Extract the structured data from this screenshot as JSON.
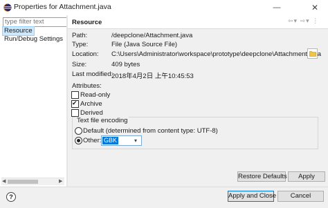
{
  "window": {
    "title": "Properties for Attachment.java"
  },
  "filter": {
    "placeholder": "type filter text"
  },
  "tree": {
    "items": [
      {
        "label": "Resource",
        "selected": true
      },
      {
        "label": "Run/Debug Settings",
        "selected": false
      }
    ]
  },
  "page": {
    "title": "Resource"
  },
  "fields": [
    {
      "label": "Path:",
      "value": "/deepclone/Attachment.java"
    },
    {
      "label": "Type:",
      "value": "File  (Java Source File)"
    },
    {
      "label": "Location:",
      "value": "C:\\Users\\Administrator\\workspace\\prototype\\deepclone\\Attachment.java"
    },
    {
      "label": "Size:",
      "value": "409  bytes"
    },
    {
      "label": "Last modified:",
      "value": "2018年4月2日 上午10:45:53"
    }
  ],
  "attributes": {
    "title": "Attributes:",
    "items": [
      {
        "label": "Read-only",
        "checked": false
      },
      {
        "label": "Archive",
        "checked": true
      },
      {
        "label": "Derived",
        "checked": false
      }
    ]
  },
  "encoding": {
    "title": "Text file encoding",
    "default_label": "Default (determined from content type: UTF-8)",
    "other_label": "Other:",
    "selected": "other",
    "other_value": "GBK"
  },
  "buttons": {
    "restore_defaults": "Restore Defaults",
    "apply": "Apply",
    "apply_and_close": "Apply and Close",
    "cancel": "Cancel"
  },
  "icons": {
    "app": "eclipse-icon",
    "help": "help-icon",
    "folder": "folder-icon",
    "nav": [
      "back-icon",
      "back-dropdown-icon",
      "forward-icon",
      "forward-dropdown-icon",
      "view-menu-icon"
    ]
  },
  "colors": {
    "selection": "#cce8ff",
    "combo_highlight": "#0078d7",
    "eclipse_purple": "#2c2255"
  }
}
